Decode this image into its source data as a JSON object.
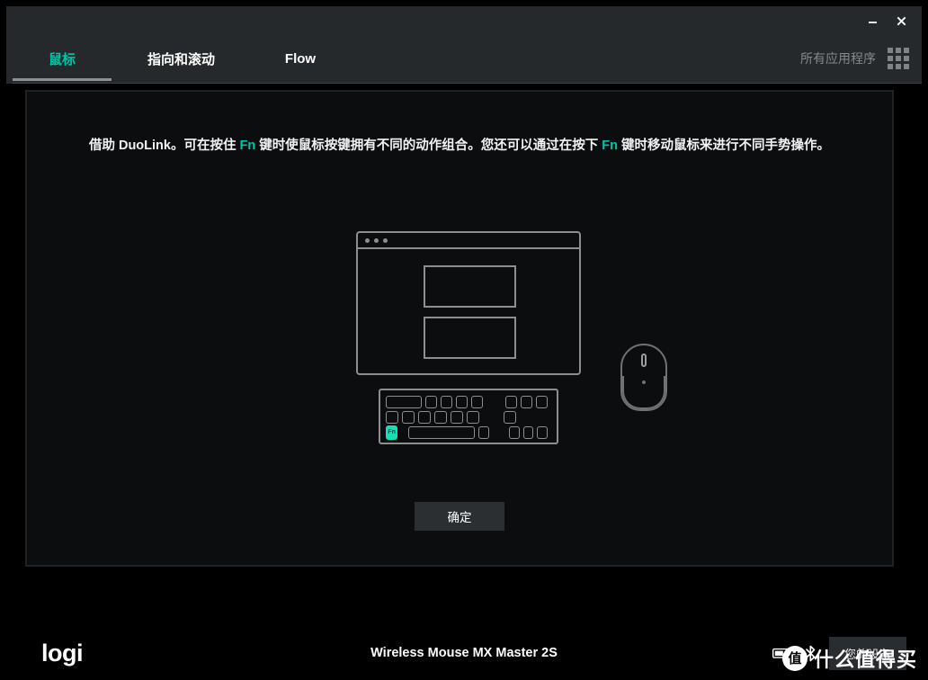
{
  "window": {
    "controls": [
      {
        "name": "minimize",
        "glyph": "minimize-icon"
      },
      {
        "name": "close",
        "glyph": "close-icon"
      }
    ]
  },
  "tabs": [
    {
      "label": "鼠标",
      "active": true
    },
    {
      "label": "指向和滚动",
      "active": false
    },
    {
      "label": "Flow",
      "active": false
    }
  ],
  "header": {
    "all_apps_label": "所有应用程序",
    "grid_icon": "grid-icon"
  },
  "main": {
    "description_part1": "借助 DuoLink。可在按住 ",
    "description_fn1": "Fn",
    "description_part2": " 键时使鼠标按键拥有不同的动作组合。您还可以通过在按下 ",
    "description_fn2": "Fn",
    "description_part3": " 键时移动鼠标来进行不同手势操作。",
    "illustration": {
      "monitor_icon": "monitor-window-icon",
      "mouse_icon": "mouse-icon",
      "keyboard_icon": "keyboard-icon",
      "fn_key_label": "Fn",
      "fn_key_color": "#14e0b5"
    },
    "ok_button": "确定"
  },
  "statusbar": {
    "logo": "logi",
    "device_name": "Wireless Mouse MX Master 2S",
    "battery_icon": "battery-icon",
    "bluetooth_icon": "bluetooth-icon",
    "your_device_button": "您的设备"
  },
  "watermark": {
    "badge": "值",
    "text": "什么值得买"
  },
  "colors": {
    "accent_teal": "#00c4a7",
    "panel_bg": "#0c0d0e",
    "chrome_bg": "#26292b"
  }
}
